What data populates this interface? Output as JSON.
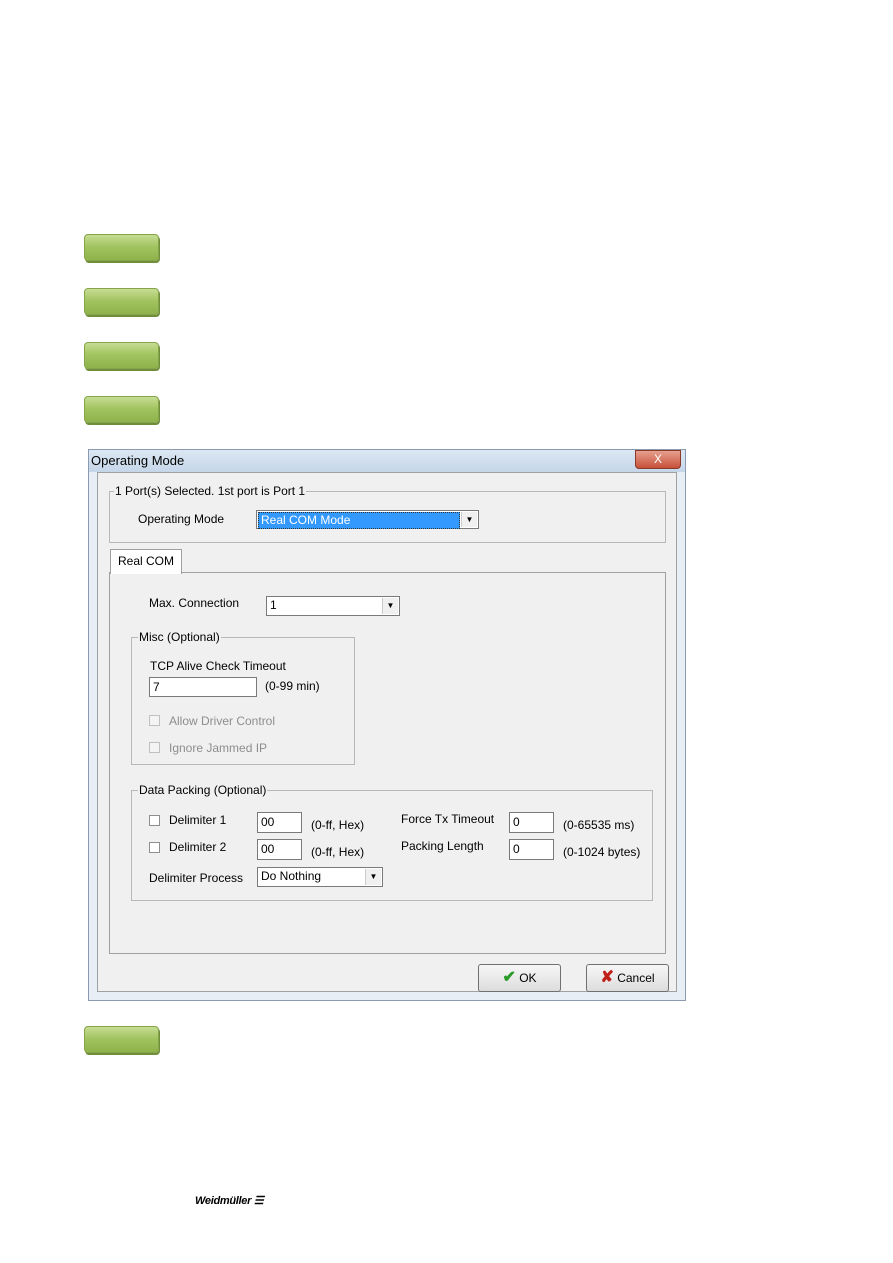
{
  "step_markers": [
    "green-marker",
    "green-marker",
    "green-marker",
    "green-marker",
    "green-marker"
  ],
  "dialog": {
    "title": "Operating Mode",
    "close_label": "X",
    "port_group": "1 Port(s) Selected. 1st port is Port 1",
    "operating_mode_label": "Operating Mode",
    "operating_mode_value": "Real COM Mode",
    "tab": "Real COM",
    "max_connection_label": "Max. Connection",
    "max_connection_value": "1",
    "misc": {
      "legend": "Misc (Optional)",
      "tcp_label": "TCP Alive Check Timeout",
      "tcp_value": "7",
      "tcp_range": "(0-99 min)",
      "allow_driver": "Allow Driver Control",
      "ignore_jammed": "Ignore Jammed IP"
    },
    "packing": {
      "legend": "Data Packing (Optional)",
      "delim1_label": "Delimiter 1",
      "delim1_value": "00",
      "delim1_range": "(0-ff, Hex)",
      "delim2_label": "Delimiter 2",
      "delim2_value": "00",
      "delim2_range": "(0-ff, Hex)",
      "process_label": "Delimiter Process",
      "process_value": "Do Nothing",
      "force_label": "Force Tx Timeout",
      "force_value": "0",
      "force_range": "(0-65535 ms)",
      "length_label": "Packing Length",
      "length_value": "0",
      "length_range": "(0-1024 bytes)"
    },
    "ok": "OK",
    "cancel": "Cancel"
  },
  "footer": {
    "logo": "Weidmüller"
  }
}
